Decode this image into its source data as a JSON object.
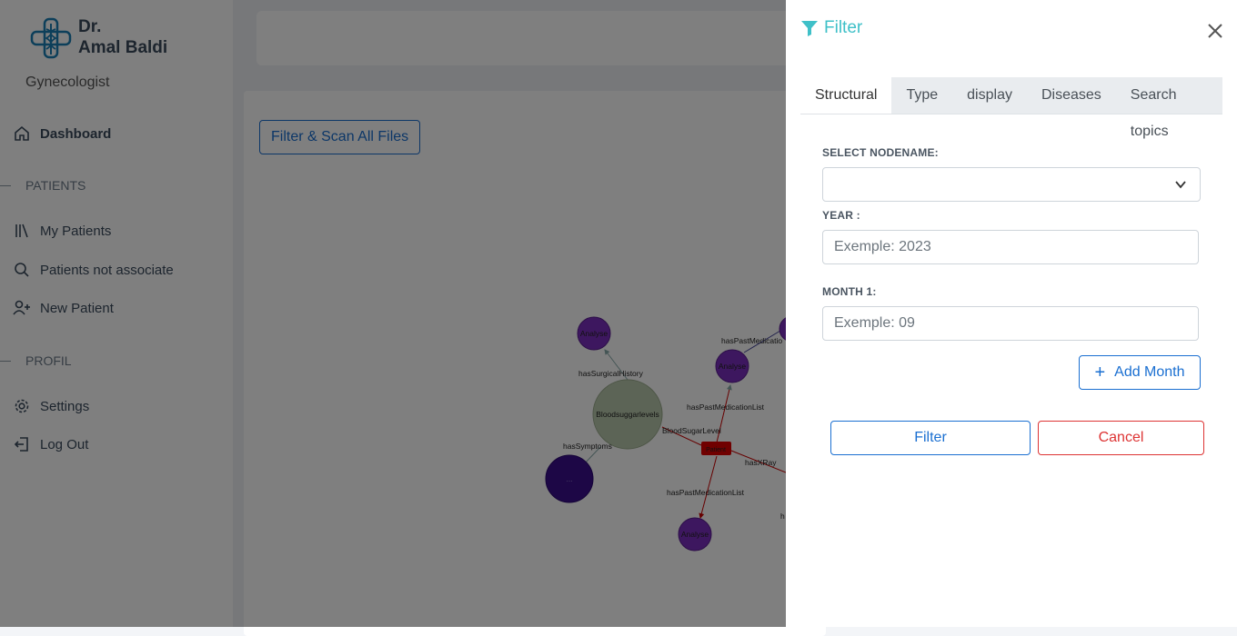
{
  "sidebar": {
    "doctor_title": "Dr.",
    "doctor_name": "Amal Baldi",
    "role": "Gynecologist",
    "dashboard": "Dashboard",
    "patients_section": "PATIENTS",
    "my_patients": "My Patients",
    "patients_not_associate": "Patients not associate",
    "new_patient": "New Patient",
    "profil_section": "PROFIL",
    "settings": "Settings",
    "log_out": "Log Out"
  },
  "main": {
    "scan_button": "Filter & Scan All Files",
    "graph": {
      "nodes": {
        "analyse1": "Analyse",
        "analyse2": "Analyse",
        "analyse3": "Analyse",
        "bloodsugar": "Bloodsuggarlevels",
        "patient": "Patient",
        "symptom_node": "...",
        "edge_surgical": "hasSurgicalHistory",
        "edge_symptoms": "hasSymptoms",
        "edge_past_med1": "hasPastMedicationList",
        "edge_past_med2": "hasPastMedicationList",
        "edge_past_med3": "hasPastMedicatio",
        "edge_blood": "BloodSugarLevel",
        "edge_xray": "hasXRay",
        "edge_h": "h"
      }
    }
  },
  "filter_panel": {
    "title": "Filter",
    "tabs": [
      "Structural",
      "Type",
      "display",
      "Diseases",
      "Search topics"
    ],
    "active_tab": "Structural",
    "nodename_label": "SELECT NODENAME:",
    "nodename_value": "",
    "year_label": "YEAR :",
    "year_placeholder": "Exemple: 2023",
    "month_label": "MONTH 1:",
    "month_placeholder": "Exemple: 09",
    "add_month": "Add Month",
    "filter_button": "Filter",
    "cancel_button": "Cancel"
  },
  "colors": {
    "accent": "#1a6fd1",
    "filter_title": "#3fc0c8",
    "cancel": "#dd3333",
    "node_purple": "#7b2fbf",
    "node_green": "#b9c9ad",
    "node_patient": "#e00000"
  }
}
